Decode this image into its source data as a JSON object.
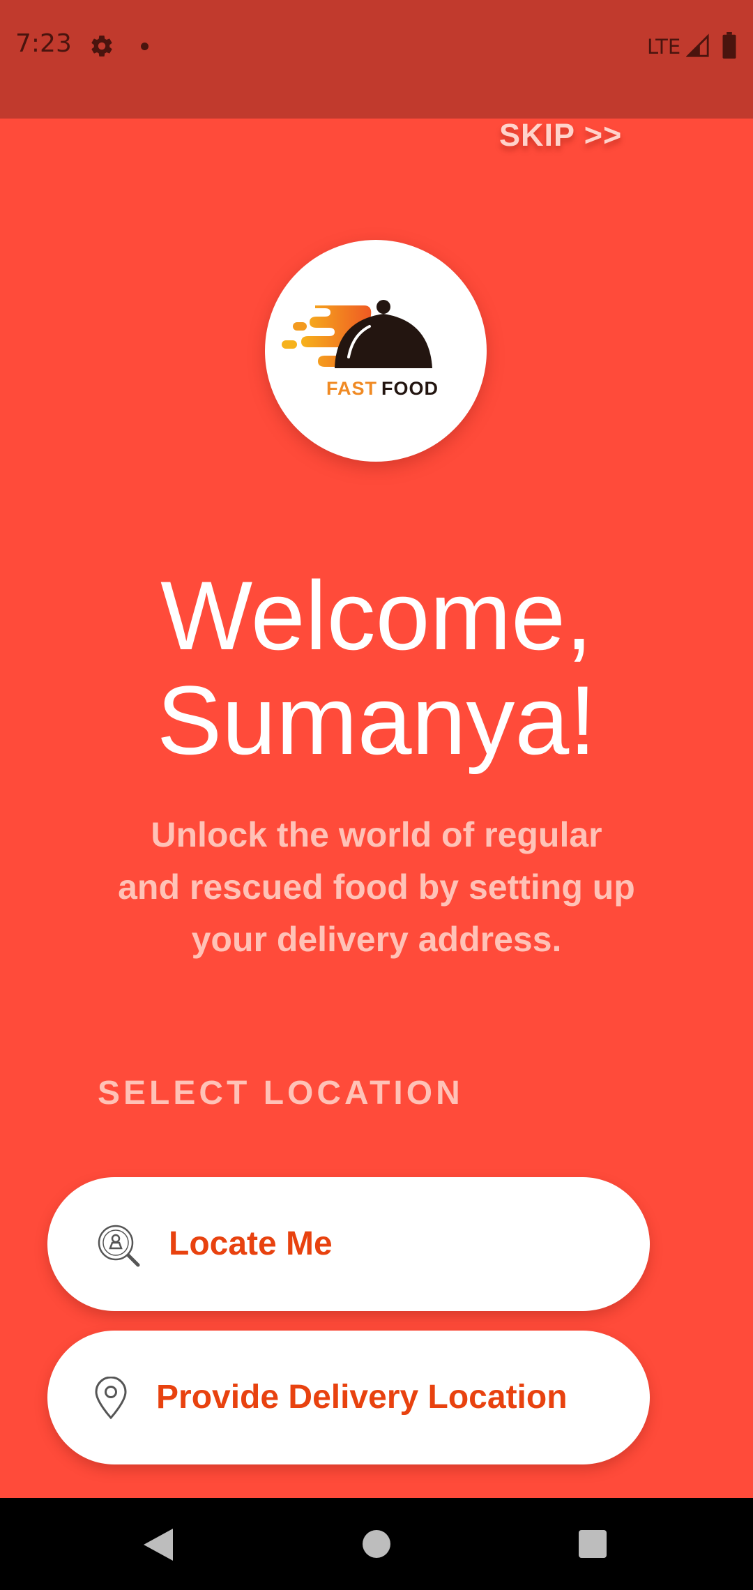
{
  "status_bar": {
    "time": "7:23",
    "network": "LTE",
    "icons": [
      "gear-icon",
      "notification-dot-icon",
      "signal-icon",
      "battery-icon"
    ]
  },
  "header": {
    "skip_label": "SKIP >>"
  },
  "logo": {
    "text_fast": "FAST",
    "text_food": "FOOD"
  },
  "welcome": {
    "line1": "Welcome,",
    "line2": "Sumanya!",
    "subtitle_line1": "Unlock the world of regular",
    "subtitle_line2": "and rescued food by setting up",
    "subtitle_line3": "your delivery address."
  },
  "location": {
    "section_label": "SELECT LOCATION",
    "locate_me_label": "Locate Me",
    "locate_me_icon": "locate-search-icon",
    "delivery_label": "Provide Delivery Location",
    "delivery_icon": "map-pin-icon"
  },
  "nav_bar": {
    "icons": [
      "back-icon",
      "home-icon",
      "recents-icon"
    ]
  },
  "colors": {
    "background": "#ff4b3a",
    "status_bar": "#c13a2d",
    "accent_text": "#e8420f",
    "muted_text": "#ffc2b7",
    "logo_orange": "#f08a24",
    "logo_dark": "#231510"
  }
}
